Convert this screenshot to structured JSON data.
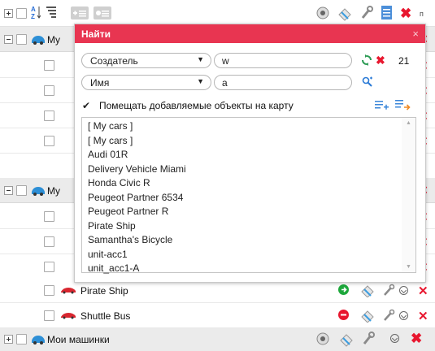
{
  "toolbar": {
    "expand_all": "expand",
    "sort_az_icon": "sort-az-icon",
    "sort_list_icon": "sort-list-icon",
    "add_list_icon": "add-list-icon",
    "remove_list_icon": "remove-list-icon",
    "truncated_text": "п"
  },
  "rows": [
    {
      "type": "group",
      "label": "My",
      "expanded": true
    },
    {
      "type": "unit",
      "label": ""
    },
    {
      "type": "unit",
      "label": ""
    },
    {
      "type": "unit",
      "label": ""
    },
    {
      "type": "unit",
      "label": ""
    },
    {
      "type": "group",
      "label": "My",
      "expanded": true
    },
    {
      "type": "unit",
      "label": ""
    },
    {
      "type": "unit",
      "label": ""
    },
    {
      "type": "unit",
      "label": ""
    },
    {
      "type": "unit",
      "label": "Pirate Ship",
      "status": "moving"
    },
    {
      "type": "unit",
      "label": "Shuttle Bus",
      "status": "stopped"
    },
    {
      "type": "group",
      "label": "Мои машинки",
      "expanded": false
    }
  ],
  "dialog": {
    "title": "Найти",
    "close": "×",
    "filter1": {
      "field": "Создатель",
      "value": "w",
      "count": "21"
    },
    "filter2": {
      "field": "Имя",
      "value": "a"
    },
    "checkbox_label": "Помещать добавляемые объекты на карту",
    "checkbox_checked": true,
    "results": [
      "[ My cars ]",
      "[ My cars ]",
      "Audi 01R",
      "Delivery Vehicle Miami",
      "Honda Civic R",
      "Peugeot Partner 6534",
      "Peugeot Partner R",
      "Pirate Ship",
      "Samantha's Bicycle",
      "unit-acc1",
      "unit_acc1-A"
    ]
  },
  "colors": {
    "accent": "#e83551",
    "delete": "#e8172f",
    "moving": "#1ea83c",
    "stopped": "#e8172f"
  }
}
